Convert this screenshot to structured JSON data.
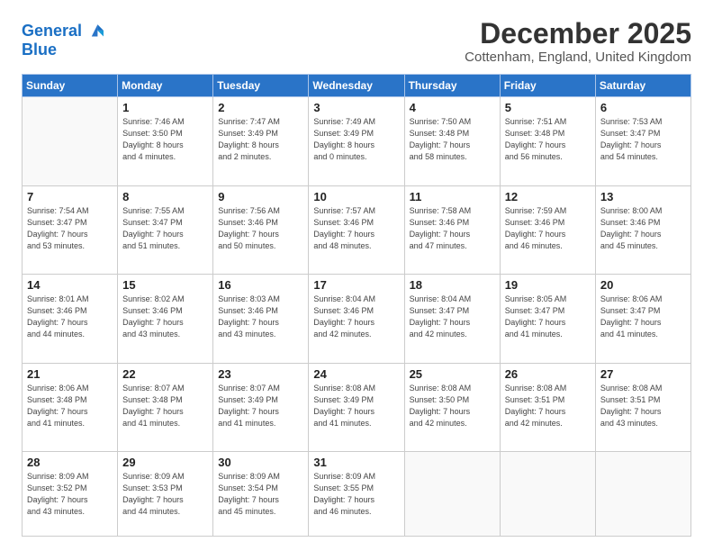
{
  "logo": {
    "line1": "General",
    "line2": "Blue"
  },
  "title": "December 2025",
  "subtitle": "Cottenham, England, United Kingdom",
  "days_of_week": [
    "Sunday",
    "Monday",
    "Tuesday",
    "Wednesday",
    "Thursday",
    "Friday",
    "Saturday"
  ],
  "weeks": [
    [
      {
        "day": "",
        "info": ""
      },
      {
        "day": "1",
        "info": "Sunrise: 7:46 AM\nSunset: 3:50 PM\nDaylight: 8 hours\nand 4 minutes."
      },
      {
        "day": "2",
        "info": "Sunrise: 7:47 AM\nSunset: 3:49 PM\nDaylight: 8 hours\nand 2 minutes."
      },
      {
        "day": "3",
        "info": "Sunrise: 7:49 AM\nSunset: 3:49 PM\nDaylight: 8 hours\nand 0 minutes."
      },
      {
        "day": "4",
        "info": "Sunrise: 7:50 AM\nSunset: 3:48 PM\nDaylight: 7 hours\nand 58 minutes."
      },
      {
        "day": "5",
        "info": "Sunrise: 7:51 AM\nSunset: 3:48 PM\nDaylight: 7 hours\nand 56 minutes."
      },
      {
        "day": "6",
        "info": "Sunrise: 7:53 AM\nSunset: 3:47 PM\nDaylight: 7 hours\nand 54 minutes."
      }
    ],
    [
      {
        "day": "7",
        "info": "Sunrise: 7:54 AM\nSunset: 3:47 PM\nDaylight: 7 hours\nand 53 minutes."
      },
      {
        "day": "8",
        "info": "Sunrise: 7:55 AM\nSunset: 3:47 PM\nDaylight: 7 hours\nand 51 minutes."
      },
      {
        "day": "9",
        "info": "Sunrise: 7:56 AM\nSunset: 3:46 PM\nDaylight: 7 hours\nand 50 minutes."
      },
      {
        "day": "10",
        "info": "Sunrise: 7:57 AM\nSunset: 3:46 PM\nDaylight: 7 hours\nand 48 minutes."
      },
      {
        "day": "11",
        "info": "Sunrise: 7:58 AM\nSunset: 3:46 PM\nDaylight: 7 hours\nand 47 minutes."
      },
      {
        "day": "12",
        "info": "Sunrise: 7:59 AM\nSunset: 3:46 PM\nDaylight: 7 hours\nand 46 minutes."
      },
      {
        "day": "13",
        "info": "Sunrise: 8:00 AM\nSunset: 3:46 PM\nDaylight: 7 hours\nand 45 minutes."
      }
    ],
    [
      {
        "day": "14",
        "info": "Sunrise: 8:01 AM\nSunset: 3:46 PM\nDaylight: 7 hours\nand 44 minutes."
      },
      {
        "day": "15",
        "info": "Sunrise: 8:02 AM\nSunset: 3:46 PM\nDaylight: 7 hours\nand 43 minutes."
      },
      {
        "day": "16",
        "info": "Sunrise: 8:03 AM\nSunset: 3:46 PM\nDaylight: 7 hours\nand 43 minutes."
      },
      {
        "day": "17",
        "info": "Sunrise: 8:04 AM\nSunset: 3:46 PM\nDaylight: 7 hours\nand 42 minutes."
      },
      {
        "day": "18",
        "info": "Sunrise: 8:04 AM\nSunset: 3:47 PM\nDaylight: 7 hours\nand 42 minutes."
      },
      {
        "day": "19",
        "info": "Sunrise: 8:05 AM\nSunset: 3:47 PM\nDaylight: 7 hours\nand 41 minutes."
      },
      {
        "day": "20",
        "info": "Sunrise: 8:06 AM\nSunset: 3:47 PM\nDaylight: 7 hours\nand 41 minutes."
      }
    ],
    [
      {
        "day": "21",
        "info": "Sunrise: 8:06 AM\nSunset: 3:48 PM\nDaylight: 7 hours\nand 41 minutes."
      },
      {
        "day": "22",
        "info": "Sunrise: 8:07 AM\nSunset: 3:48 PM\nDaylight: 7 hours\nand 41 minutes."
      },
      {
        "day": "23",
        "info": "Sunrise: 8:07 AM\nSunset: 3:49 PM\nDaylight: 7 hours\nand 41 minutes."
      },
      {
        "day": "24",
        "info": "Sunrise: 8:08 AM\nSunset: 3:49 PM\nDaylight: 7 hours\nand 41 minutes."
      },
      {
        "day": "25",
        "info": "Sunrise: 8:08 AM\nSunset: 3:50 PM\nDaylight: 7 hours\nand 42 minutes."
      },
      {
        "day": "26",
        "info": "Sunrise: 8:08 AM\nSunset: 3:51 PM\nDaylight: 7 hours\nand 42 minutes."
      },
      {
        "day": "27",
        "info": "Sunrise: 8:08 AM\nSunset: 3:51 PM\nDaylight: 7 hours\nand 43 minutes."
      }
    ],
    [
      {
        "day": "28",
        "info": "Sunrise: 8:09 AM\nSunset: 3:52 PM\nDaylight: 7 hours\nand 43 minutes."
      },
      {
        "day": "29",
        "info": "Sunrise: 8:09 AM\nSunset: 3:53 PM\nDaylight: 7 hours\nand 44 minutes."
      },
      {
        "day": "30",
        "info": "Sunrise: 8:09 AM\nSunset: 3:54 PM\nDaylight: 7 hours\nand 45 minutes."
      },
      {
        "day": "31",
        "info": "Sunrise: 8:09 AM\nSunset: 3:55 PM\nDaylight: 7 hours\nand 46 minutes."
      },
      {
        "day": "",
        "info": ""
      },
      {
        "day": "",
        "info": ""
      },
      {
        "day": "",
        "info": ""
      }
    ]
  ]
}
